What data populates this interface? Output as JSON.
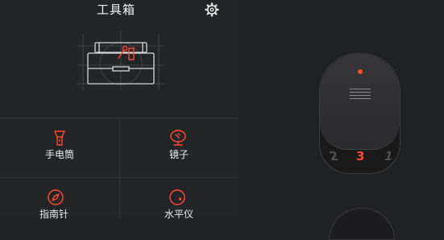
{
  "app": {
    "title": "工具箱",
    "settings_icon": "gear-icon",
    "hero_icon": "toolbox-icon"
  },
  "tools": [
    {
      "label": "手电筒",
      "icon": "flashlight-icon"
    },
    {
      "label": "镜子",
      "icon": "mirror-icon"
    },
    {
      "label": "指南针",
      "icon": "compass-icon"
    },
    {
      "label": "水平仪",
      "icon": "level-icon"
    }
  ],
  "lens_selector": {
    "options": [
      "2",
      "3",
      "1"
    ],
    "selected": "3"
  },
  "colors": {
    "accent": "#ff4a2f",
    "background": "#242526",
    "divider": "#333436"
  }
}
